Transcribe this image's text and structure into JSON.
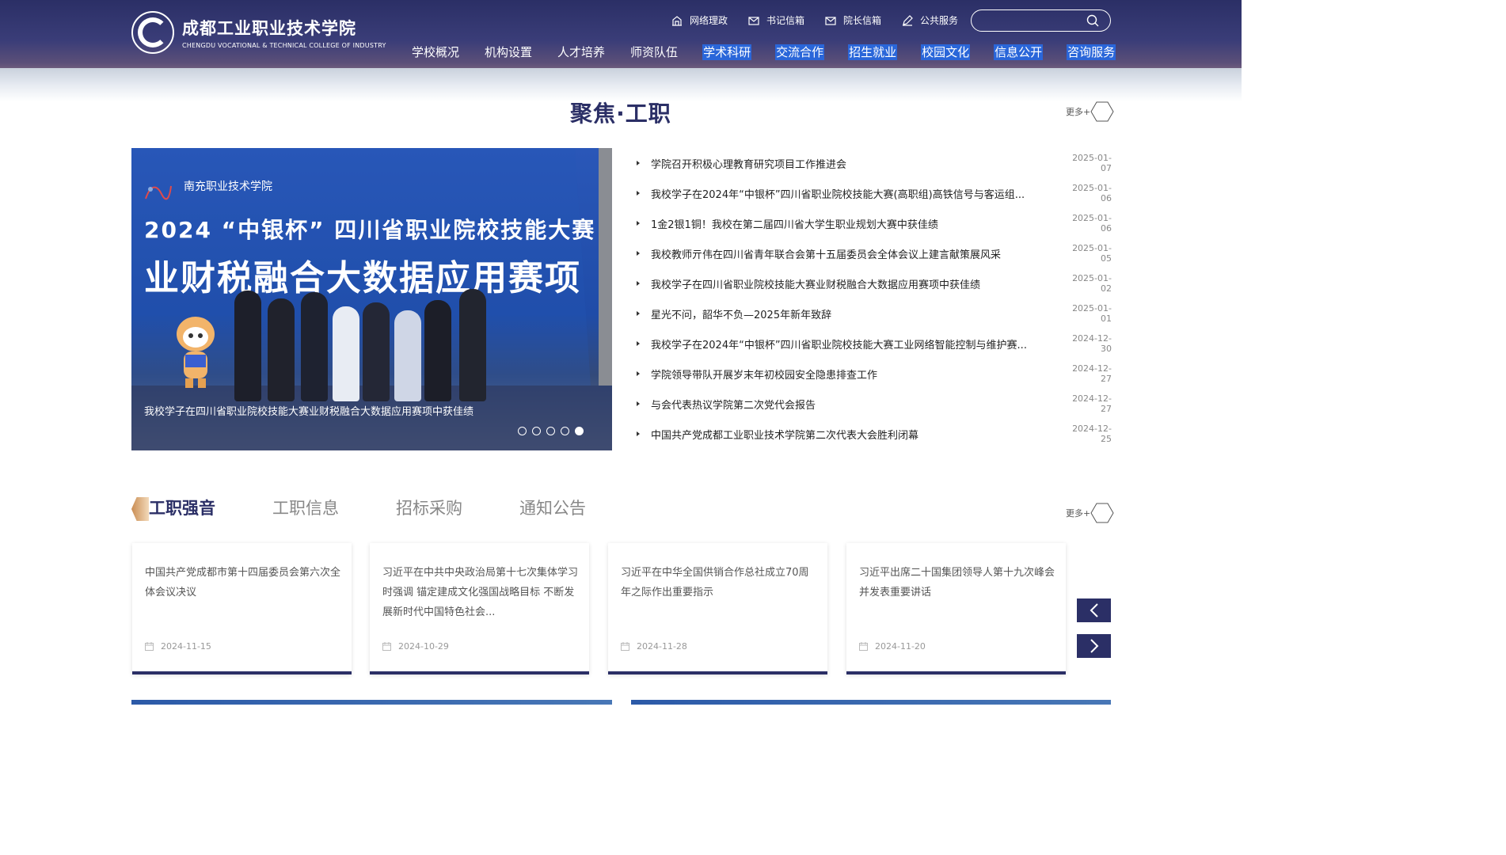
{
  "header": {
    "logo_cn": "成都工业职业技术学院",
    "logo_en": "CHENGDU VOCATIONAL & TECHNICAL COLLEGE OF INDUSTRY",
    "top_links": [
      {
        "label": "网络理政",
        "icon": "building-icon"
      },
      {
        "label": "书记信箱",
        "icon": "mail-icon"
      },
      {
        "label": "院长信箱",
        "icon": "mail-icon"
      },
      {
        "label": "公共服务",
        "icon": "pen-icon"
      }
    ],
    "search_placeholder": "",
    "nav": [
      {
        "label": "学校概况",
        "highlight": false
      },
      {
        "label": "机构设置",
        "highlight": false
      },
      {
        "label": "人才培养",
        "highlight": false
      },
      {
        "label": "师资队伍",
        "highlight": false
      },
      {
        "label": "学术科研",
        "highlight": true
      },
      {
        "label": "交流合作",
        "highlight": true
      },
      {
        "label": "招生就业",
        "highlight": true
      },
      {
        "label": "校园文化",
        "highlight": true
      },
      {
        "label": "信息公开",
        "highlight": true
      },
      {
        "label": "咨询服务",
        "highlight": true
      }
    ]
  },
  "focus": {
    "title": "聚焦·工职",
    "more": "更多+",
    "banner": {
      "school_logo_text": "南充职业技术学院",
      "line1": "2024 “中银杯” 四川省职业院校技能大赛",
      "line2": "业财税融合大数据应用赛项",
      "caption": "我校学子在四川省职业院校技能大赛业财税融合大数据应用赛项中获佳绩",
      "slides": 5,
      "active_slide": 5
    },
    "news": [
      {
        "title": "学院召开积极心理教育研究项目工作推进会",
        "date": "2025-01-07"
      },
      {
        "title": "我校学子在2024年“中银杯”四川省职业院校技能大赛(高职组)高铁信号与客运组...",
        "date": "2025-01-06"
      },
      {
        "title": "1金2银1铜！我校在第二届四川省大学生职业规划大赛中获佳绩",
        "date": "2025-01-06"
      },
      {
        "title": "我校教师亓伟在四川省青年联合会第十五届委员会全体会议上建言献策展风采",
        "date": "2025-01-05"
      },
      {
        "title": "我校学子在四川省职业院校技能大赛业财税融合大数据应用赛项中获佳绩",
        "date": "2025-01-02"
      },
      {
        "title": "星光不问，韶华不负—2025年新年致辞",
        "date": "2025-01-01"
      },
      {
        "title": "我校学子在2024年“中银杯”四川省职业院校技能大赛工业网络智能控制与维护赛...",
        "date": "2024-12-30"
      },
      {
        "title": "学院领导带队开展岁末年初校园安全隐患排查工作",
        "date": "2024-12-27"
      },
      {
        "title": "与会代表热议学院第二次党代会报告",
        "date": "2024-12-27"
      },
      {
        "title": "中国共产党成都工业职业技术学院第二次代表大会胜利闭幕",
        "date": "2024-12-25"
      }
    ]
  },
  "voice": {
    "tabs": [
      "工职强音",
      "工职信息",
      "招标采购",
      "通知公告"
    ],
    "active_tab": 0,
    "more": "更多+",
    "cards": [
      {
        "title": "中国共产党成都市第十四届委员会第六次全体会议决议",
        "date": "2024-11-15"
      },
      {
        "title": "习近平在中共中央政治局第十七次集体学习时强调 锚定建成文化强国战略目标 不断发展新时代中国特色社会...",
        "date": "2024-10-29"
      },
      {
        "title": "习近平在中华全国供销合作总社成立70周年之际作出重要指示",
        "date": "2024-11-28"
      },
      {
        "title": "习近平出席二十国集团领导人第十九次峰会并发表重要讲话",
        "date": "2024-11-20"
      }
    ]
  },
  "colors": {
    "brand": "#2b2f66",
    "nav_highlight": "#2a66d9",
    "banner_blue": "#1f4ca8",
    "accent_gold": "#c98d53"
  }
}
